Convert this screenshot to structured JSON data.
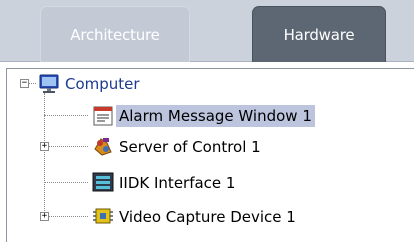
{
  "tabs": [
    {
      "label": "Architecture",
      "active": false
    },
    {
      "label": "Hardware",
      "active": true
    }
  ],
  "tree": {
    "root": {
      "label": "Computer",
      "expanded": true,
      "icon": "computer-monitor-icon"
    },
    "children": [
      {
        "label": "Alarm Message Window 1",
        "selected": true,
        "expandable": false,
        "icon": "alarm-window-icon"
      },
      {
        "label": "Server of Control 1",
        "selected": false,
        "expandable": true,
        "icon": "server-control-icon"
      },
      {
        "label": "IIDK Interface 1",
        "selected": false,
        "expandable": false,
        "icon": "interface-icon"
      },
      {
        "label": "Video Capture Device 1",
        "selected": false,
        "expandable": true,
        "icon": "video-capture-chip-icon"
      }
    ]
  },
  "colors": {
    "tabbar_bg": "#ccd2dc",
    "active_tab_bg": "#5d6673",
    "selection_bg": "#bcc5dd",
    "root_label": "#1c3b8f"
  }
}
